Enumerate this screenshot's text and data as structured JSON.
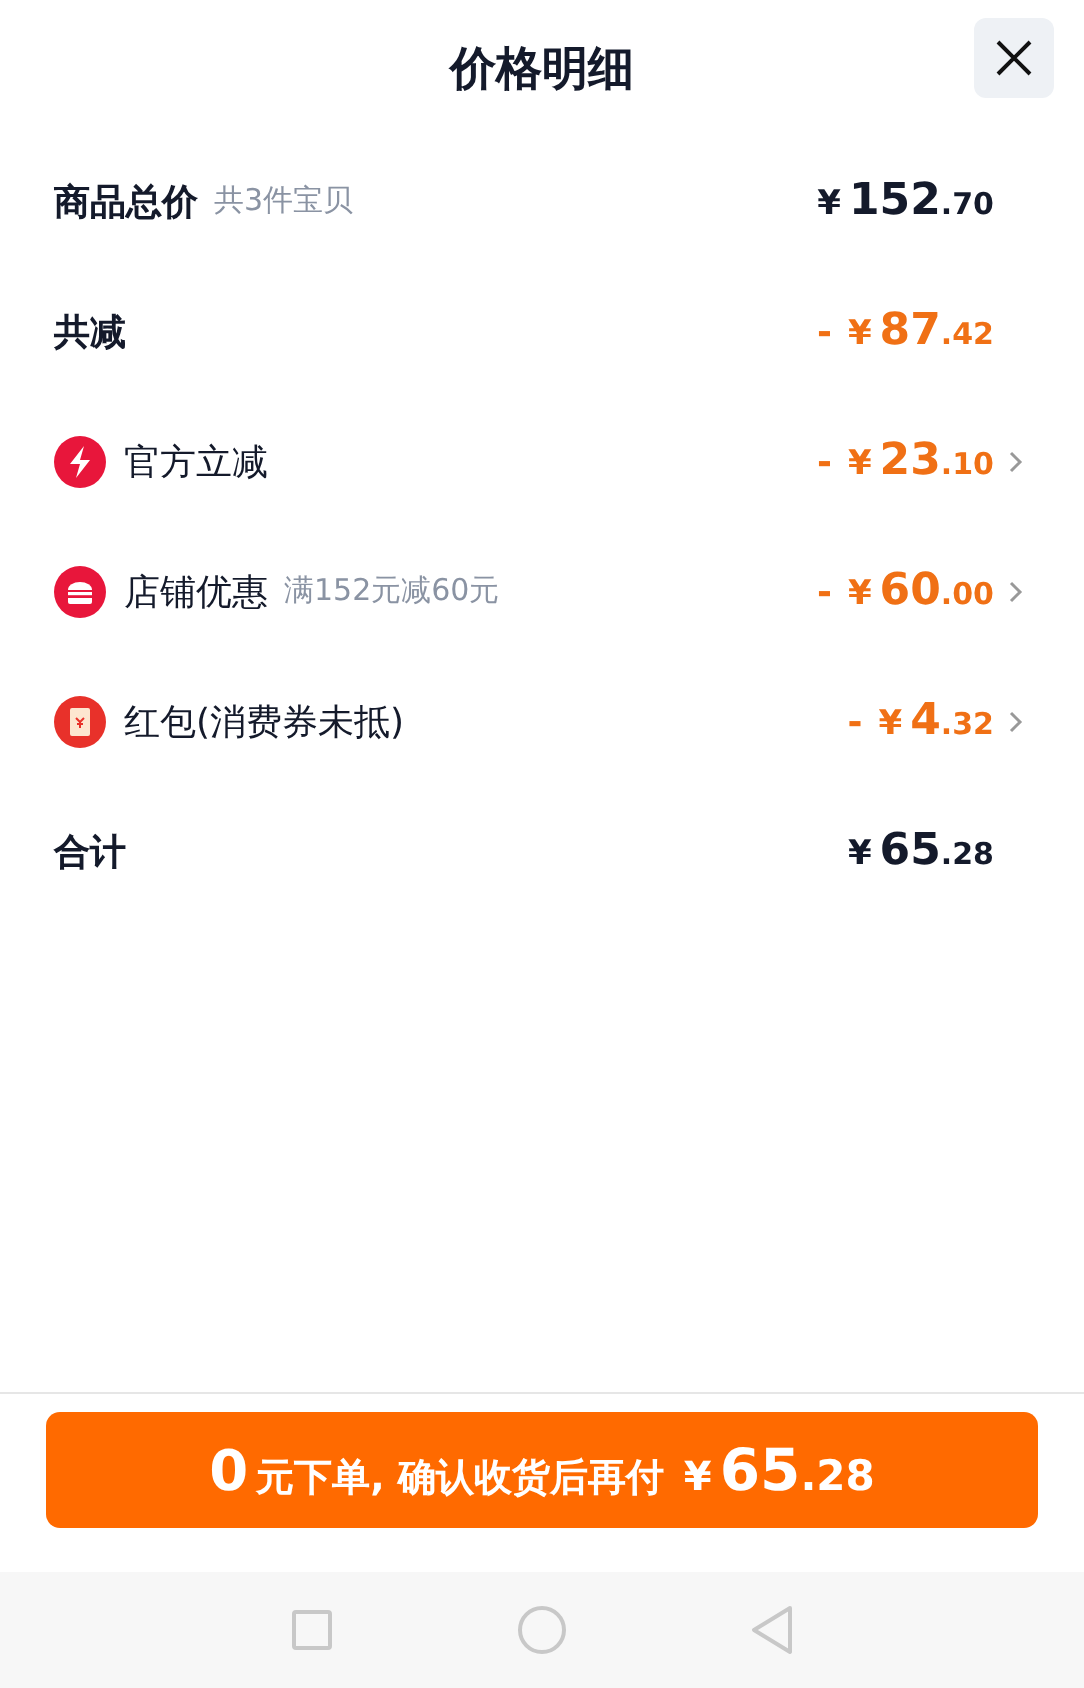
{
  "header": {
    "title": "价格明细"
  },
  "rows": [
    {
      "kind": "plain",
      "label": "商品总价",
      "note": "共3件宝贝",
      "color": "#141a2b",
      "minus": "",
      "currency": "¥",
      "integer": "152",
      "decimal": ".70",
      "chevron": false
    },
    {
      "kind": "plain",
      "label": "共减",
      "color": "#f07015",
      "minus": "-",
      "currency": "¥",
      "integer": "87",
      "decimal": ".42",
      "chevron": false
    },
    {
      "kind": "bolt",
      "label": "官方立减",
      "color": "#f07015",
      "minus": "-",
      "currency": "¥",
      "integer": "23",
      "decimal": ".10",
      "chevron": true
    },
    {
      "kind": "store",
      "label": "店铺优惠",
      "note": "满152元减60元",
      "color": "#f07015",
      "minus": "-",
      "currency": "¥",
      "integer": "60",
      "decimal": ".00",
      "chevron": true
    },
    {
      "kind": "envelope",
      "label": "红包(消费券未抵)",
      "color": "#f07015",
      "minus": "-",
      "currency": "¥",
      "integer": "4",
      "decimal": ".32",
      "chevron": true
    },
    {
      "kind": "plain",
      "label": "合计",
      "color": "#141a2b",
      "minus": "",
      "currency": "¥",
      "integer": "65",
      "decimal": ".28",
      "chevron": false
    }
  ],
  "pay_button": {
    "lead": "0",
    "text": "元下单, 确认收货后再付",
    "currency": "¥",
    "integer": "65",
    "decimal": ".28"
  }
}
